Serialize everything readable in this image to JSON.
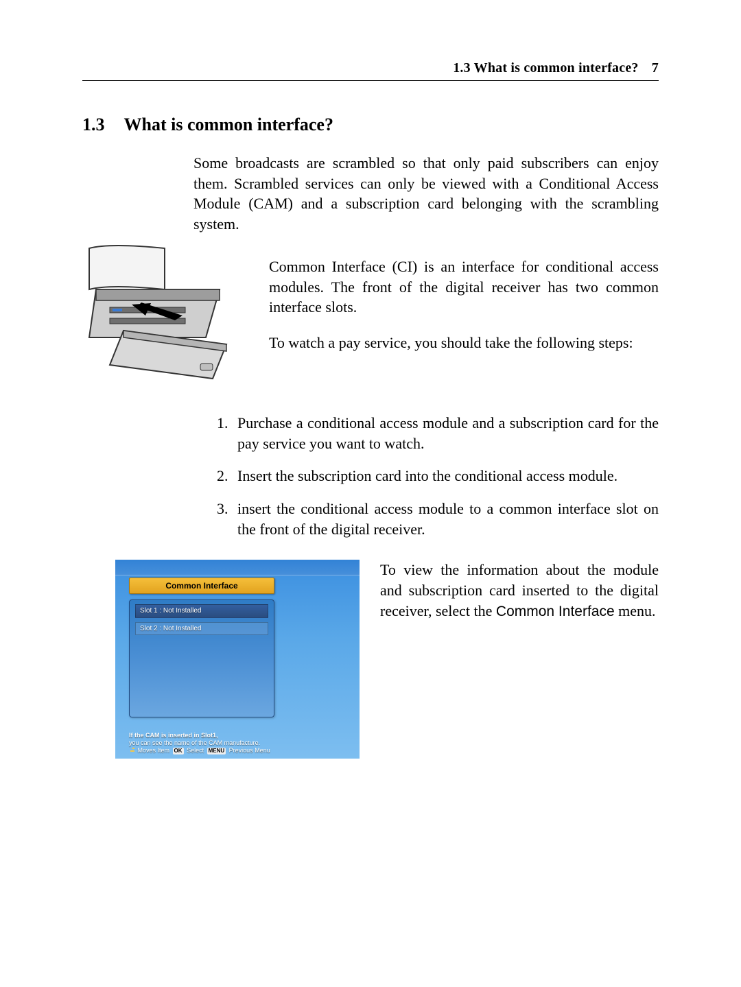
{
  "header": {
    "section_ref": "1.3 What is common interface?",
    "page_number": "7"
  },
  "section": {
    "number": "1.3",
    "title": "What is common interface?"
  },
  "para_intro": "Some broadcasts are scrambled so that only paid subscribers can enjoy them. Scrambled services can only be viewed with a Conditional Access Module (CAM) and a subscription card belonging with the scrambling system.",
  "para_ci": "Common Interface (CI) is an interface for conditional access modules. The front of the digital receiver has two common interface slots.",
  "para_steps_lead": "To watch a pay service, you should take the following steps:",
  "steps": [
    "Purchase a conditional access module and a subscription card for the pay service you want to watch.",
    "Insert the subscription card into the conditional access module.",
    "insert the conditional access module to a common interface slot on the front of the digital receiver."
  ],
  "para_after_pre": "To view the information about the module and subscription card inserted to the digital receiver, select the ",
  "menu_label": "Common Interface",
  "para_after_post": " menu.",
  "ci_screen": {
    "title": "Common Interface",
    "slot1": "Slot 1 : Not Installed",
    "slot2": "Slot 2 : Not Installed",
    "hint1": "If the CAM is inserted in Slot1,",
    "hint2": "you can see the name of the CAM manufacture.",
    "nav_moves": "Moves Item",
    "nav_ok": "OK",
    "nav_select": "Select",
    "nav_menu": "MENU",
    "nav_prev": "Previous Menu"
  }
}
